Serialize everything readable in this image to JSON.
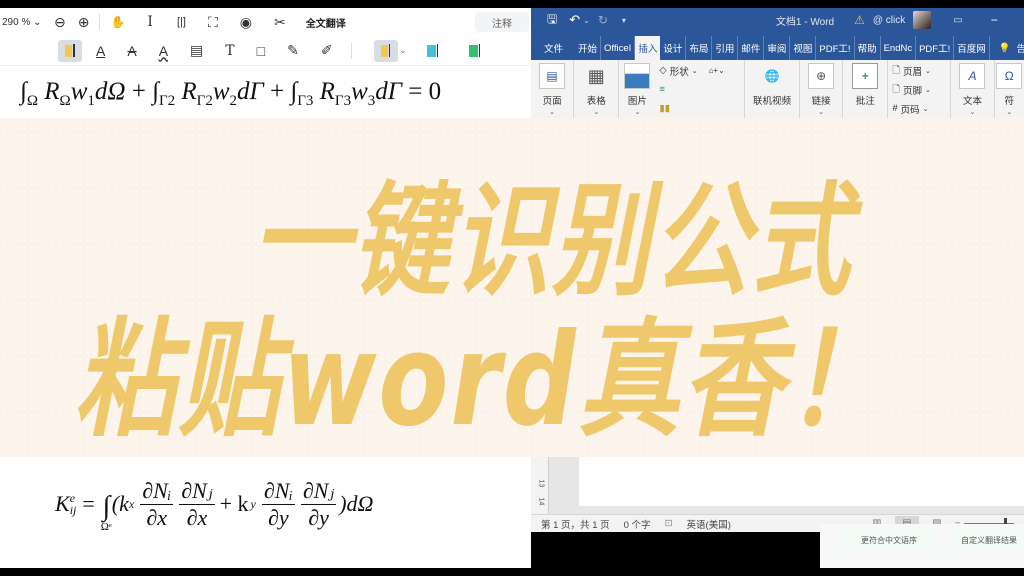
{
  "pdf_viewer": {
    "zoom_level": "290 %",
    "toolbar": {
      "zoom_out": "⊖",
      "zoom_in": "⊕",
      "hand_tool": "✋",
      "text_select": "I",
      "fit_width": "[|]",
      "fullscreen": "⛶",
      "eye_protect": "◉",
      "screenshot": "✂",
      "translate_label": "全文翻译",
      "annotation_label": "注释"
    },
    "annot_toolbar": {
      "underline": "A",
      "strikethrough": "A",
      "squiggly": "A",
      "comment": "▤",
      "text": "T",
      "rectangle": "□",
      "pen": "✎",
      "eraser": "✐",
      "highlight_color": "#f0c94a",
      "cyan_color": "#3ec6d8",
      "green_color": "#2fc36b"
    },
    "formula_top": {
      "int1_sub": "Ω",
      "R1": "R",
      "R1_sub": "Ω",
      "w1": "w",
      "w1_sub": "1",
      "d1": "dΩ",
      "plus": "+",
      "int2_sub": "Γ2",
      "R2_sub": "Γ2",
      "w2_sub": "2",
      "d2": "dΓ",
      "int3_sub": "Γ3",
      "R3_sub": "Γ3",
      "w3_sub": "3",
      "d3": "dΓ",
      "eq": "= 0"
    },
    "formula_bottom": {
      "K": "K",
      "K_sup": "e",
      "K_sub": "ij",
      "eq": "=",
      "int_sub": "Ωᵉ",
      "open": "(k",
      "kx_sub": "x",
      "num1": "∂Nᵢ",
      "den1": "∂x",
      "num2": "∂Nⱼ",
      "den2": "∂x",
      "plus": "+ k",
      "ky_sub": "y",
      "num3": "∂Nᵢ",
      "den3": "∂y",
      "num4": "∂Nⱼ",
      "den4": "∂y",
      "close": ")dΩ"
    }
  },
  "word": {
    "title": "文档1 - Word",
    "warning_icon": "⚠",
    "account": "@ click",
    "quick_access": {
      "save": "🖫",
      "undo": "↶",
      "redo": "↻",
      "more": "▾"
    },
    "tabs": [
      "文件",
      "开始",
      "OfficeI",
      "插入",
      "设计",
      "布局",
      "引用",
      "邮件",
      "审阅",
      "视图",
      "PDF工!",
      "帮助",
      "EndNc",
      "PDF工!",
      "百度网"
    ],
    "active_tab": "插入",
    "tell_me_icon": "💡",
    "tell_me_partial": "告",
    "ribbon": {
      "page": "页面",
      "table": "表格",
      "picture": "图片",
      "shapes": "形状",
      "online_video": "联机视频",
      "link": "链接",
      "comment": "批注",
      "header": "页眉",
      "footer": "页脚",
      "page_number": "页码",
      "text": "文本",
      "symbol_partial": "符"
    },
    "ruler_marks": [
      "13",
      "14"
    ],
    "status": {
      "page_info": "第 1 页，共 1 页",
      "word_count": "0 个字",
      "language": "英语(美国)"
    }
  },
  "translate_panel": {
    "card1": "更符合中文语序",
    "card2": "自定义翻译结果"
  },
  "banner": {
    "line1": "一键识别公式",
    "line2": "粘贴word真香！",
    "text_color": "#eec86a",
    "bg_color": "#fcf3ea"
  }
}
